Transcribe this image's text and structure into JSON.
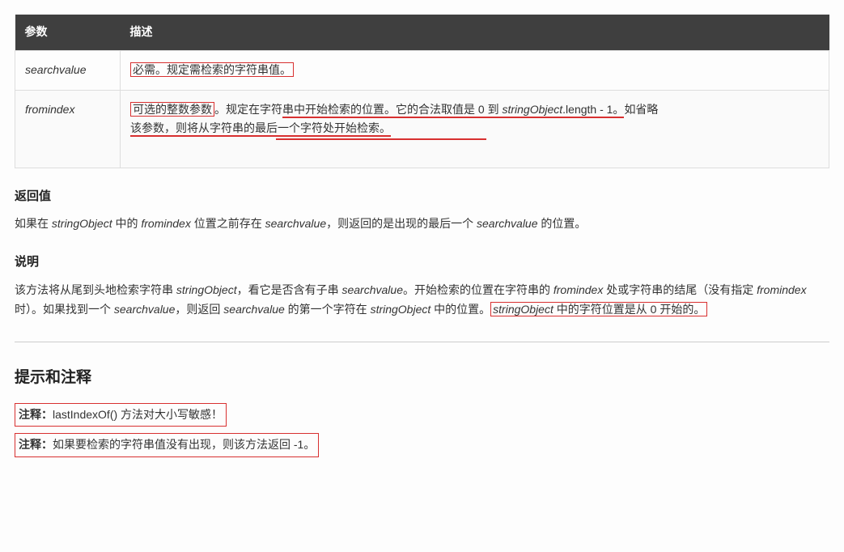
{
  "table": {
    "headers": {
      "param": "参数",
      "desc": "描述"
    },
    "rows": [
      {
        "name": "searchvalue",
        "desc_boxed": "必需。规定需检索的字符串值。"
      },
      {
        "name": "fromindex",
        "seg_a": "可选的整数参数",
        "seg_b": "。规定在字符",
        "seg_c": "串中开始检索的位置。它的合法取值是 0 到 ",
        "seg_d_ital": "stringObject",
        "seg_e_under": ".length - 1。",
        "seg_f": "如省略",
        "seg_g_under": "该参数，则将从字符串的最后一个字符处开始检索。"
      }
    ]
  },
  "return_heading": "返回值",
  "return_p": {
    "a": "如果在 ",
    "b_ital": "stringObject",
    "c": " 中的 ",
    "d_ital": "fromindex",
    "e": " 位置之前存在 ",
    "f_ital": "searchvalue",
    "g": "，则返回的是出现的最后一个 ",
    "h_ital": "searchvalue",
    "i": " 的位置。"
  },
  "explain_heading": "说明",
  "explain_p": {
    "a": "该方法将从尾到头地检索字符串 ",
    "b_ital": "stringObject",
    "c": "，看它是否含有子串 ",
    "d_ital": "searchvalue",
    "e": "。开始检索的位置在字符串的 ",
    "f_ital": "fromindex",
    "g": " 处或字符串的结尾（没有指定 ",
    "h_ital": "fromindex",
    "i": " 时）。如果找到一个 ",
    "j_ital": "searchvalue",
    "k": "，则返回 ",
    "l_ital": "searchvalue",
    "m": " 的第一个字符在 ",
    "n_ital": "stringObject",
    "o": " 中的位置。",
    "p_box_ital": "stringObject",
    "p_box_rest": " 中的字符位置是从 0 开始的。"
  },
  "tips_heading": "提示和注释",
  "note1": {
    "label": "注释：",
    "text": "lastIndexOf() 方法对大小写敏感！"
  },
  "note2": {
    "label": "注释：",
    "text": "如果要检索的字符串值没有出现，则该方法返回 -1。"
  }
}
